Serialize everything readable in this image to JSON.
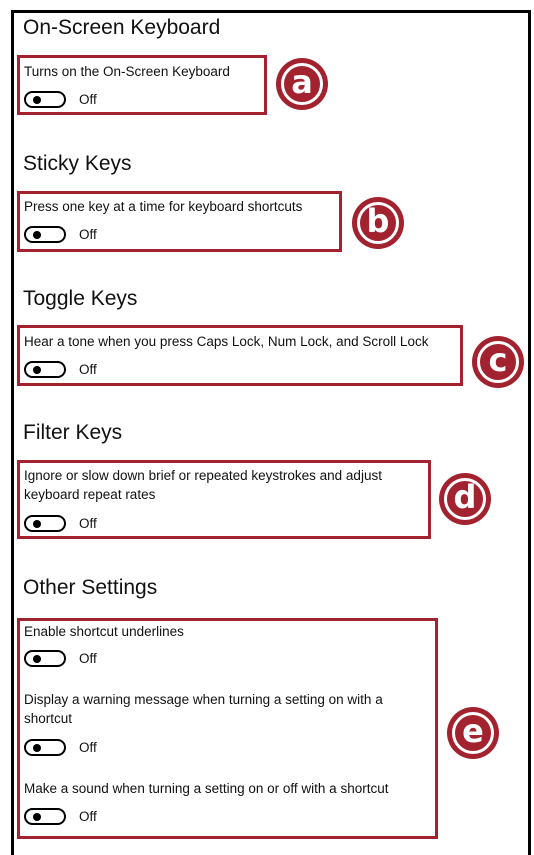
{
  "sections": [
    {
      "title": "On-Screen Keyboard",
      "desc": "Turns on the On-Screen Keyboard",
      "state": "Off",
      "badge": "a"
    },
    {
      "title": "Sticky Keys",
      "desc": "Press one key at a time for keyboard shortcuts",
      "state": "Off",
      "badge": "b"
    },
    {
      "title": "Toggle Keys",
      "desc": "Hear a tone when you press Caps Lock, Num Lock, and Scroll Lock",
      "state": "Off",
      "badge": "c"
    },
    {
      "title": "Filter Keys",
      "desc_line1": "Ignore or slow down brief or repeated keystrokes and adjust",
      "desc_line2": "keyboard repeat rates",
      "state": "Off",
      "badge": "d"
    }
  ],
  "other": {
    "title": "Other Settings",
    "badge": "e",
    "items": [
      {
        "desc": "Enable shortcut underlines",
        "state": "Off"
      },
      {
        "desc_line1": "Display a warning message when turning a setting on with a",
        "desc_line2": "shortcut",
        "state": "Off"
      },
      {
        "desc": "Make a sound when turning a setting on or off with a shortcut",
        "state": "Off"
      }
    ]
  },
  "colors": {
    "highlight": "#a3222f",
    "toggle_off": "#000000",
    "background": "#ffffff"
  }
}
